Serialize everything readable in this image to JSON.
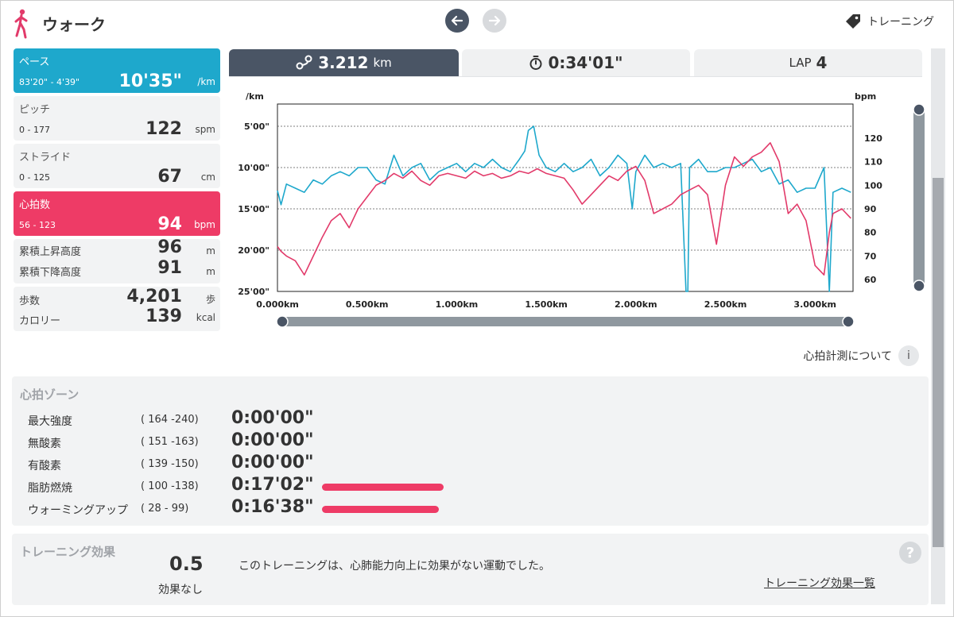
{
  "header": {
    "title": "ウォーク",
    "training_label": "トレーニング"
  },
  "stats": {
    "pace": {
      "label": "ペース",
      "range": "83'20\" - 4'39\"",
      "value": "10'35\"",
      "unit": "/km"
    },
    "pitch": {
      "label": "ピッチ",
      "range": "0 - 177",
      "value": "122",
      "unit": "spm"
    },
    "stride": {
      "label": "ストライド",
      "range": "0 - 125",
      "value": "67",
      "unit": "cm"
    },
    "heart_rate": {
      "label": "心拍数",
      "range": "56 - 123",
      "value": "94",
      "unit": "bpm"
    },
    "ascent": {
      "label": "累積上昇高度",
      "value": "96",
      "unit": "m"
    },
    "descent": {
      "label": "累積下降高度",
      "value": "91",
      "unit": "m"
    },
    "steps": {
      "label": "歩数",
      "value": "4,201",
      "unit": "歩"
    },
    "calories": {
      "label": "カロリー",
      "value": "139",
      "unit": "kcal"
    }
  },
  "tabs": {
    "distance_value": "3.212",
    "distance_unit": "km",
    "time_value": "0:34'01\"",
    "lap_label": "LAP",
    "lap_value": "4"
  },
  "colors": {
    "accent_cyan": "#1ea8cc",
    "accent_pink": "#ee3b66",
    "tab_dark": "#4a5565"
  },
  "chart_data": {
    "type": "line",
    "xlabel": "",
    "x_ticks": [
      "0.000km",
      "0.500km",
      "1.000km",
      "1.500km",
      "2.000km",
      "2.500km",
      "3.000km"
    ],
    "xlim": [
      0,
      3.212
    ],
    "left_axis": {
      "unit": "/km",
      "ticks": [
        "5'00\"",
        "10'00\"",
        "15'00\"",
        "20'00\"",
        "25'00\""
      ],
      "range_min": [
        5,
        25
      ]
    },
    "right_axis": {
      "unit": "bpm",
      "ticks": [
        "120",
        "110",
        "100",
        "90",
        "80",
        "70",
        "60"
      ],
      "range": [
        55,
        125
      ]
    },
    "grid": true,
    "series": [
      {
        "color": "#1ea8cc",
        "axis": "left",
        "x": [
          0.0,
          0.02,
          0.05,
          0.1,
          0.15,
          0.2,
          0.25,
          0.3,
          0.35,
          0.4,
          0.45,
          0.5,
          0.55,
          0.6,
          0.65,
          0.7,
          0.75,
          0.8,
          0.85,
          0.9,
          0.95,
          1.0,
          1.05,
          1.1,
          1.15,
          1.2,
          1.25,
          1.3,
          1.35,
          1.38,
          1.4,
          1.43,
          1.46,
          1.5,
          1.55,
          1.6,
          1.65,
          1.7,
          1.75,
          1.8,
          1.85,
          1.9,
          1.95,
          1.98,
          2.0,
          2.05,
          2.1,
          2.15,
          2.2,
          2.25,
          2.28,
          2.29,
          2.3,
          2.35,
          2.4,
          2.45,
          2.5,
          2.55,
          2.6,
          2.65,
          2.7,
          2.75,
          2.8,
          2.85,
          2.9,
          2.95,
          3.0,
          3.05,
          3.08,
          3.1,
          3.15,
          3.2
        ],
        "y": [
          12.8,
          14.5,
          12.0,
          12.5,
          13.0,
          11.5,
          12.0,
          11.0,
          10.5,
          11.0,
          10.0,
          10.0,
          11.5,
          12.0,
          8.5,
          11.0,
          10.0,
          9.5,
          11.5,
          10.5,
          10.0,
          9.5,
          10.5,
          9.5,
          10.0,
          9.0,
          10.0,
          10.5,
          9.0,
          8.0,
          5.5,
          5.0,
          8.5,
          10.0,
          10.5,
          9.5,
          10.5,
          10.0,
          9.0,
          11.0,
          10.0,
          8.5,
          9.5,
          15.0,
          10.5,
          8.5,
          10.0,
          9.5,
          10.0,
          9.5,
          25.0,
          25.0,
          10.0,
          9.0,
          10.5,
          10.5,
          10.0,
          10.0,
          9.5,
          9.0,
          10.5,
          10.0,
          12.0,
          11.5,
          13.0,
          12.5,
          12.5,
          10.0,
          25.0,
          13.0,
          12.5,
          13.0
        ]
      },
      {
        "color": "#e23a6a",
        "axis": "right",
        "x": [
          0.0,
          0.02,
          0.05,
          0.1,
          0.15,
          0.2,
          0.25,
          0.3,
          0.35,
          0.4,
          0.45,
          0.5,
          0.55,
          0.6,
          0.65,
          0.7,
          0.75,
          0.8,
          0.85,
          0.9,
          0.95,
          1.0,
          1.05,
          1.1,
          1.15,
          1.2,
          1.25,
          1.3,
          1.35,
          1.4,
          1.45,
          1.5,
          1.55,
          1.6,
          1.65,
          1.7,
          1.75,
          1.8,
          1.85,
          1.9,
          1.95,
          2.0,
          2.05,
          2.1,
          2.15,
          2.2,
          2.25,
          2.3,
          2.35,
          2.4,
          2.45,
          2.5,
          2.55,
          2.6,
          2.65,
          2.7,
          2.75,
          2.8,
          2.85,
          2.9,
          2.95,
          3.0,
          3.05,
          3.08,
          3.1,
          3.15,
          3.2
        ],
        "y": [
          74,
          72,
          70,
          68,
          62,
          70,
          78,
          85,
          88,
          82,
          90,
          95,
          100,
          102,
          105,
          103,
          106,
          102,
          100,
          104,
          105,
          104,
          103,
          106,
          104,
          105,
          103,
          104,
          106,
          105,
          107,
          105,
          104,
          103,
          98,
          92,
          96,
          100,
          104,
          102,
          106,
          108,
          102,
          88,
          90,
          92,
          96,
          98,
          100,
          96,
          75,
          100,
          112,
          108,
          112,
          114,
          118,
          110,
          88,
          92,
          85,
          66,
          62,
          80,
          88,
          90,
          86
        ]
      }
    ]
  },
  "hr_about_label": "心拍計測について",
  "zones": {
    "title": "心拍ゾーン",
    "rows": [
      {
        "name": "最大強度",
        "range": "( 164 -240)",
        "time": "0:00'00\"",
        "fraction": 0.0
      },
      {
        "name": "無酸素",
        "range": "( 151 -163)",
        "time": "0:00'00\"",
        "fraction": 0.0
      },
      {
        "name": "有酸素",
        "range": "( 139 -150)",
        "time": "0:00'00\"",
        "fraction": 0.0
      },
      {
        "name": "脂肪燃焼",
        "range": "( 100 -138)",
        "time": "0:17'02\"",
        "fraction": 0.51
      },
      {
        "name": "ウォーミングアップ",
        "range": "( 28 - 99)",
        "time": "0:16'38\"",
        "fraction": 0.49
      }
    ]
  },
  "effect": {
    "title": "トレーニング効果",
    "value": "0.5",
    "level": "効果なし",
    "message": "このトレーニングは、心肺能力向上に効果がない運動でした。",
    "list_link": "トレーニング効果一覧"
  }
}
